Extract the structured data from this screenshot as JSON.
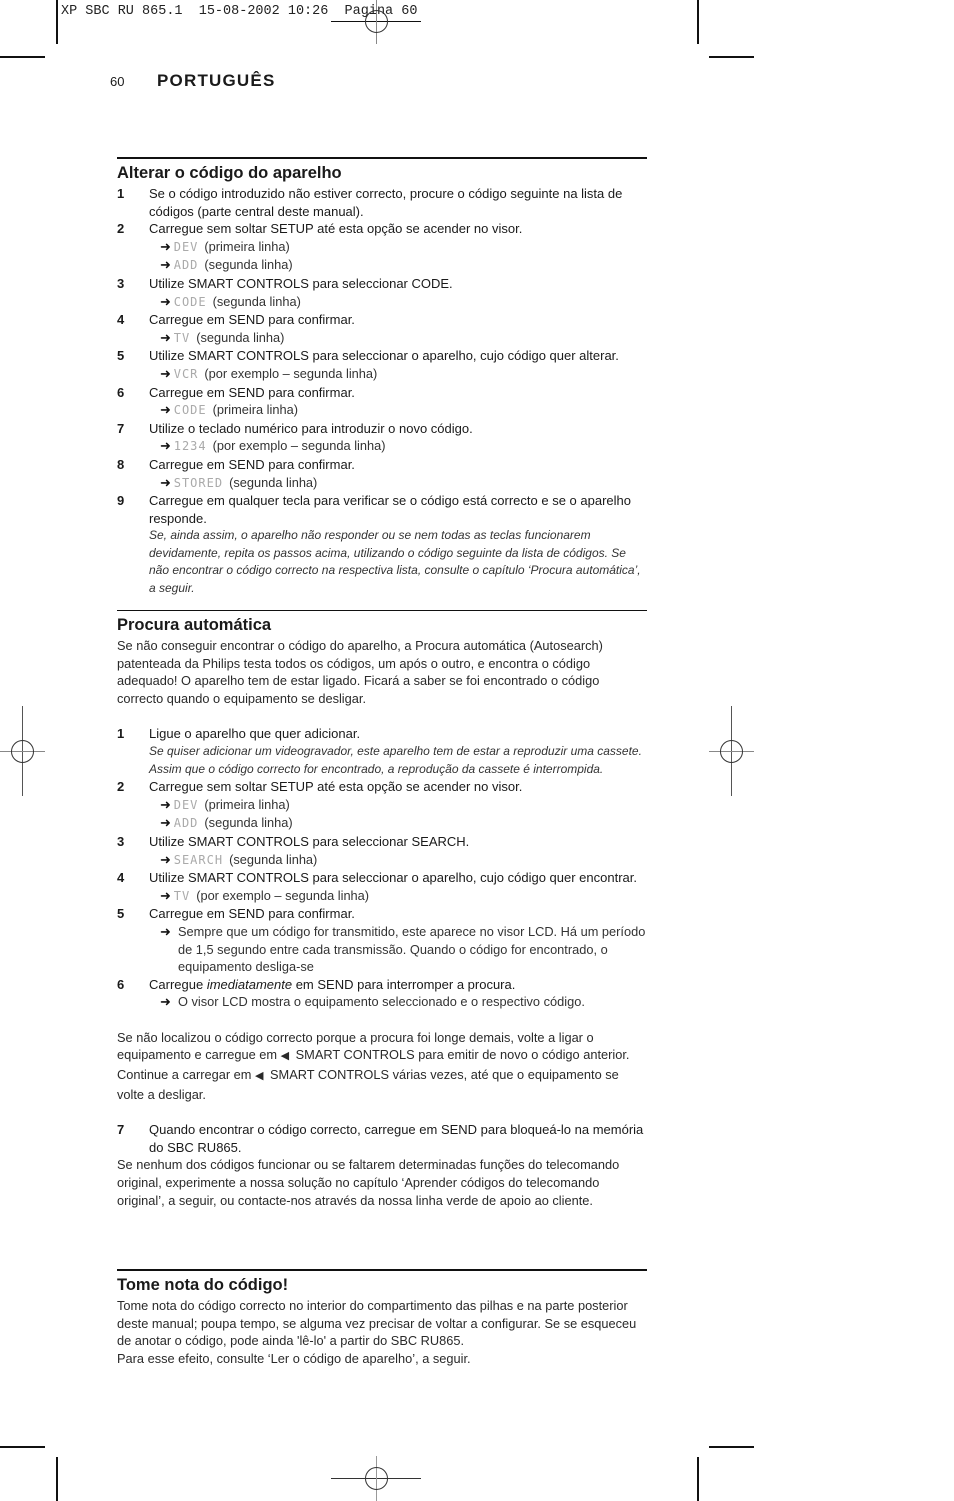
{
  "print_slug": "XP SBC RU 865.1  15-08-2002 10:26  Pagina 60",
  "header": {
    "page_number": "60",
    "language": "PORTUGUÊS"
  },
  "icons": {
    "arrow": "➜",
    "left_triangle": "◀"
  },
  "sections": [
    {
      "title": "Alterar o código do aparelho",
      "steps": [
        {
          "num": "1",
          "text": "Se o código introduzido não estiver correcto, procure o código seguinte na lista de códigos (parte central deste manual).",
          "results": []
        },
        {
          "num": "2",
          "text": "Carregue sem soltar SETUP até esta opção se acender no visor.",
          "results": [
            {
              "lcd": "DEV",
              "text": "(primeira linha)"
            },
            {
              "lcd": "ADD",
              "text": "(segunda linha)"
            }
          ]
        },
        {
          "num": "3",
          "text": "Utilize SMART CONTROLS para seleccionar CODE.",
          "results": [
            {
              "lcd": "CODE",
              "text": "(segunda linha)"
            }
          ]
        },
        {
          "num": "4",
          "text": "Carregue em SEND para confirmar.",
          "results": [
            {
              "lcd": "TV",
              "text": "(segunda linha)"
            }
          ]
        },
        {
          "num": "5",
          "text": "Utilize SMART CONTROLS para seleccionar o aparelho, cujo código quer alterar.",
          "results": [
            {
              "lcd": "VCR",
              "text": "(por exemplo – segunda linha)"
            }
          ]
        },
        {
          "num": "6",
          "text": "Carregue em SEND para confirmar.",
          "results": [
            {
              "lcd": "CODE",
              "text": "(primeira linha)"
            }
          ]
        },
        {
          "num": "7",
          "text": "Utilize o teclado numérico para introduzir o novo código.",
          "results": [
            {
              "lcd": "1234",
              "text": "(por exemplo – segunda linha)"
            }
          ]
        },
        {
          "num": "8",
          "text": "Carregue em SEND para confirmar.",
          "results": [
            {
              "lcd": "STORED",
              "text": "(segunda linha)"
            }
          ]
        },
        {
          "num": "9",
          "text": "Carregue em qualquer tecla para verificar se o código está correcto e se o aparelho responde.",
          "note": "Se, ainda assim, o aparelho não responder ou se nem todas as teclas funcionarem devidamente, repita os passos acima, utilizando o código seguinte da lista de códigos. Se não encontrar o código correcto na respectiva lista, consulte o capítulo ‘Procura automática’, a seguir."
        }
      ]
    },
    {
      "title": "Procura automática",
      "intro": "Se não conseguir encontrar o código do aparelho, a Procura automática (Autosearch) patenteada da Philips testa todos os códigos, um após o outro, e encontra o código adequado! O aparelho tem de estar ligado. Ficará a saber se foi encontrado o código correcto quando o equipamento se desligar.",
      "steps": [
        {
          "num": "1",
          "text": "Ligue o aparelho que quer adicionar.",
          "note": "Se quiser adicionar um videogravador, este aparelho tem de estar a reproduzir uma cassete. Assim que o código correcto for encontrado, a reprodução da cassete é interrompida."
        },
        {
          "num": "2",
          "text": "Carregue sem soltar SETUP até esta opção se acender no visor.",
          "results": [
            {
              "lcd": "DEV",
              "text": "(primeira linha)"
            },
            {
              "lcd": "ADD",
              "text": "(segunda linha)"
            }
          ]
        },
        {
          "num": "3",
          "text": "Utilize SMART CONTROLS para seleccionar SEARCH.",
          "results": [
            {
              "lcd": "SEARCH",
              "text": "(segunda linha)"
            }
          ]
        },
        {
          "num": "4",
          "text": "Utilize SMART CONTROLS para seleccionar o aparelho, cujo código quer encontrar.",
          "results": [
            {
              "lcd": "TV",
              "text": "(por exemplo – segunda linha)"
            }
          ]
        },
        {
          "num": "5",
          "text": "Carregue em SEND para confirmar.",
          "result_text": "Sempre que um código for transmitido, este aparece no visor LCD. Há um período de 1,5 segundo entre cada transmissão. Quando o código for encontrado, o equipamento desliga-se"
        },
        {
          "num": "6",
          "text_before": "Carregue ",
          "text_em": "imediatamente",
          "text_after": " em SEND para interromper a procura.",
          "result_text": "O visor LCD mostra o equipamento seleccionado e o respectivo código."
        }
      ],
      "after_para": {
        "p1": "Se não localizou o código correcto porque a procura foi longe demais, volte a ligar o equipamento e carregue em ",
        "p2": " SMART CONTROLS para emitir de novo o código anterior. Continue a carregar em ",
        "p3": " SMART CONTROLS várias vezes, até que o equipamento se volte a desligar."
      },
      "step7": {
        "num": "7",
        "text": "Quando encontrar o código correcto, carregue em SEND para bloqueá-lo na memória do SBC RU865."
      },
      "closing": "Se nenhum dos códigos funcionar ou se faltarem determinadas funções do telecomando original, experimente a nossa solução no capítulo ‘Aprender códigos do telecomando original’, a seguir, ou contacte-nos através da nossa linha verde de apoio ao cliente."
    },
    {
      "title": "Tome nota do código!",
      "body": "Tome nota do código correcto no interior do compartimento das pilhas e na parte posterior deste manual; poupa tempo, se alguma vez precisar de voltar a configurar. Se se esqueceu de anotar o código, pode ainda 'lê-lo' a partir do SBC RU865.",
      "body2": "Para esse efeito, consulte ‘Ler o código de aparelho’, a seguir."
    }
  ]
}
